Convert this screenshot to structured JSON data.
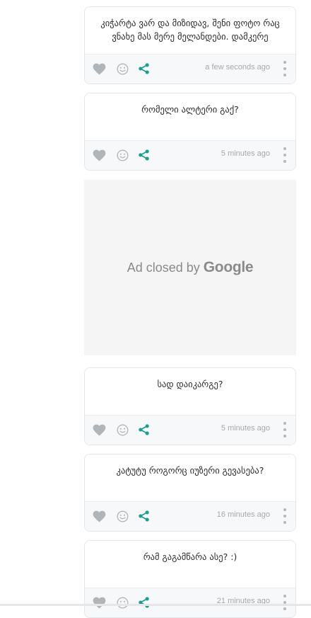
{
  "posts": [
    {
      "text": "კიჭარტა ვარ და მიზიდავ, შენი ფოტო რაც ვნახე მას მერე მელანდები. დამკერე",
      "time": "a few seconds ago"
    },
    {
      "text": "რომელი ალტერი გაქ?",
      "time": "5 minutes ago"
    },
    {
      "text": "სად დაიკარგე?",
      "time": "5 minutes ago"
    },
    {
      "text": "კატუტუ როგორც იუზერი გევასება?",
      "time": "16 minutes ago"
    },
    {
      "text": "რამ გაგამწარა ასე? :)",
      "time": "21 minutes ago"
    }
  ],
  "ad": {
    "text": "Ad closed by",
    "brand": "Google"
  },
  "colors": {
    "heart": "#b0b5b9",
    "smile": "#b0b5b9",
    "share": "#1a9e8f",
    "time": "#a3a9ae"
  },
  "icons": [
    "heart-icon",
    "smile-icon",
    "share-icon",
    "more-vertical-icon"
  ]
}
